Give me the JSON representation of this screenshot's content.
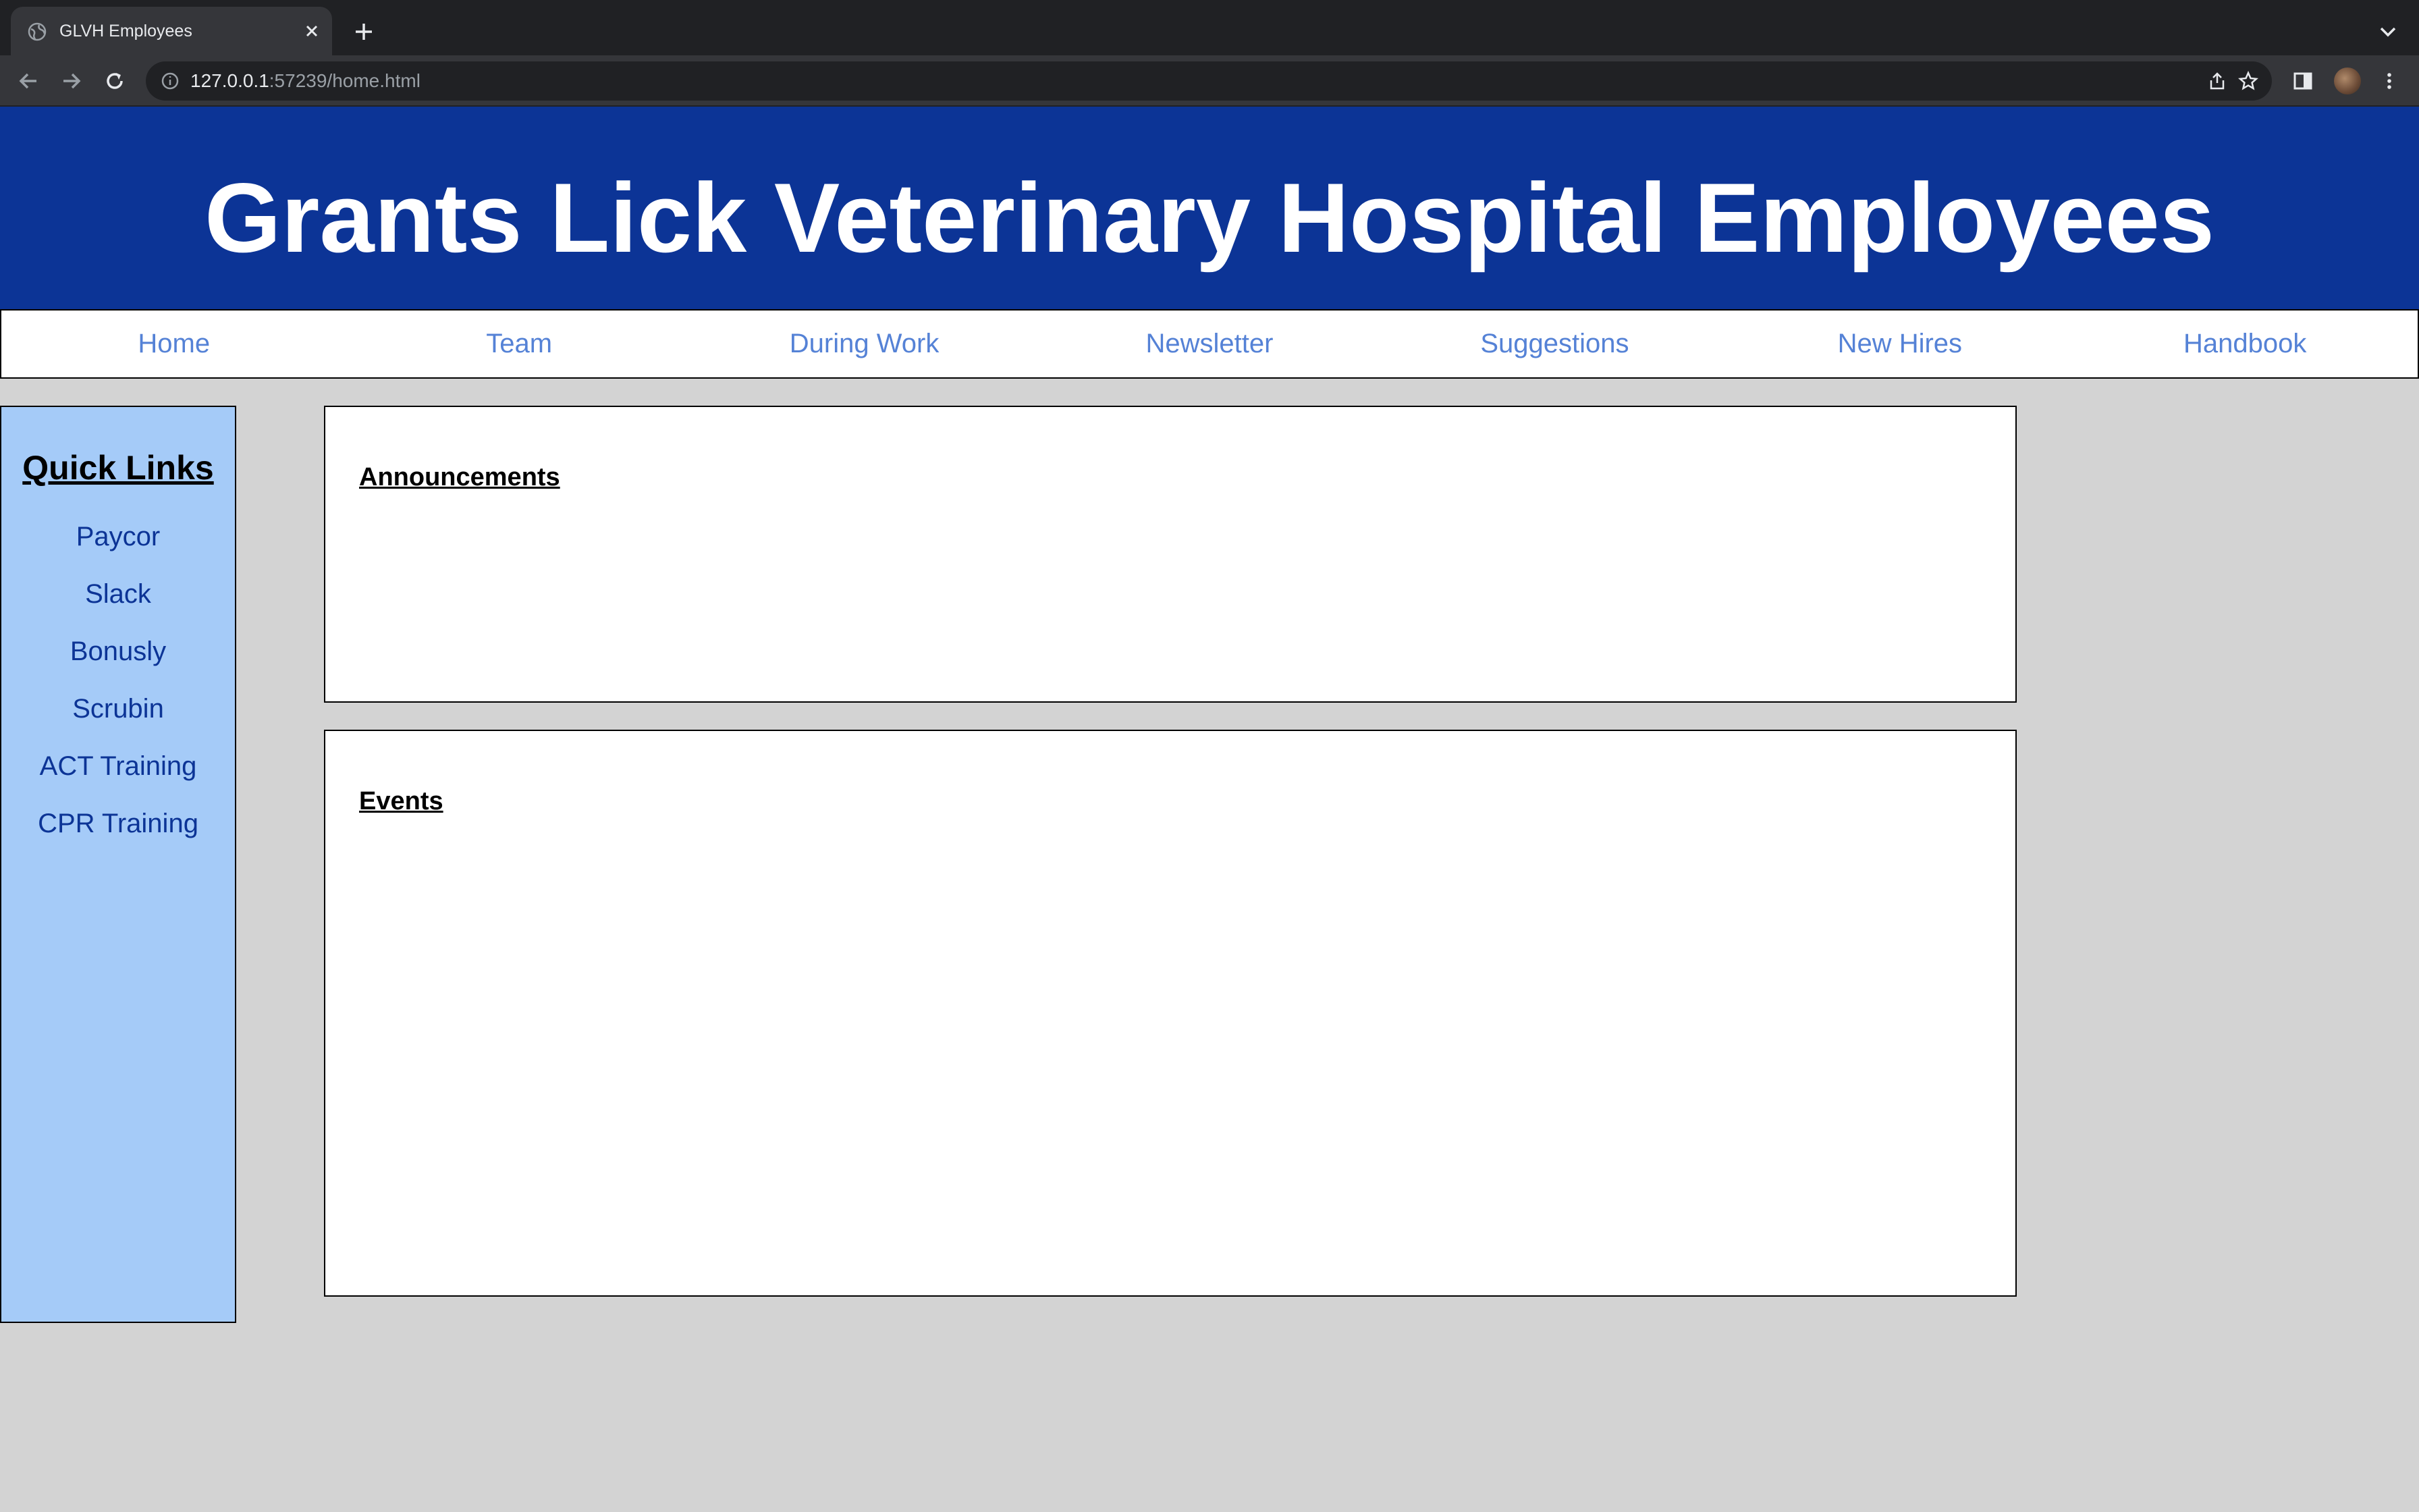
{
  "browser": {
    "tab_title": "GLVH Employees",
    "url_host": "127.0.0.1",
    "url_rest": ":57239/home.html"
  },
  "header": {
    "title": "Grants Lick Veterinary Hospital Employees"
  },
  "nav": {
    "items": [
      "Home",
      "Team",
      "During Work",
      "Newsletter",
      "Suggestions",
      "New Hires",
      "Handbook"
    ]
  },
  "sidebar": {
    "title": "Quick Links",
    "links": [
      "Paycor",
      "Slack",
      "Bonusly",
      "Scrubin",
      "ACT Training",
      "CPR Training"
    ]
  },
  "main": {
    "announcements_title": "Announcements",
    "events_title": "Events"
  },
  "colors": {
    "banner": "#0c3496",
    "nav_link": "#5582d6",
    "sidebar_bg": "#a5cbf8",
    "page_bg": "#d3d3d3"
  }
}
